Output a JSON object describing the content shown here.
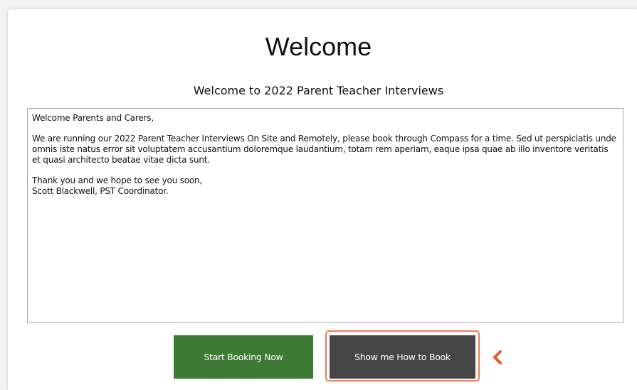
{
  "page": {
    "title": "Welcome",
    "subtitle": "Welcome to 2022 Parent Teacher Interviews"
  },
  "message": {
    "greeting": "Welcome Parents and Carers,",
    "body": "We are running our 2022 Parent Teacher Interviews On Site and Remotely, please book through Compass for a time. Sed ut perspiciatis unde omnis iste natus error sit voluptatem accusantium doloremque laudantium, totam rem aperiam, eaque ipsa quae ab illo inventore veritatis et quasi architecto beatae vitae dicta sunt.",
    "closing": "Thank you and we hope to see you soon,",
    "signature": "Scott Blackwell, PST Coordinator."
  },
  "actions": {
    "start_label": "Start Booking Now",
    "how_label": "Show me How to Book"
  },
  "pointer": {
    "icon": "chevron-left-icon"
  },
  "colors": {
    "start_button": "#3d7a33",
    "how_button": "#454545",
    "highlight": "#f07a52",
    "pointer": "#e8572f"
  }
}
